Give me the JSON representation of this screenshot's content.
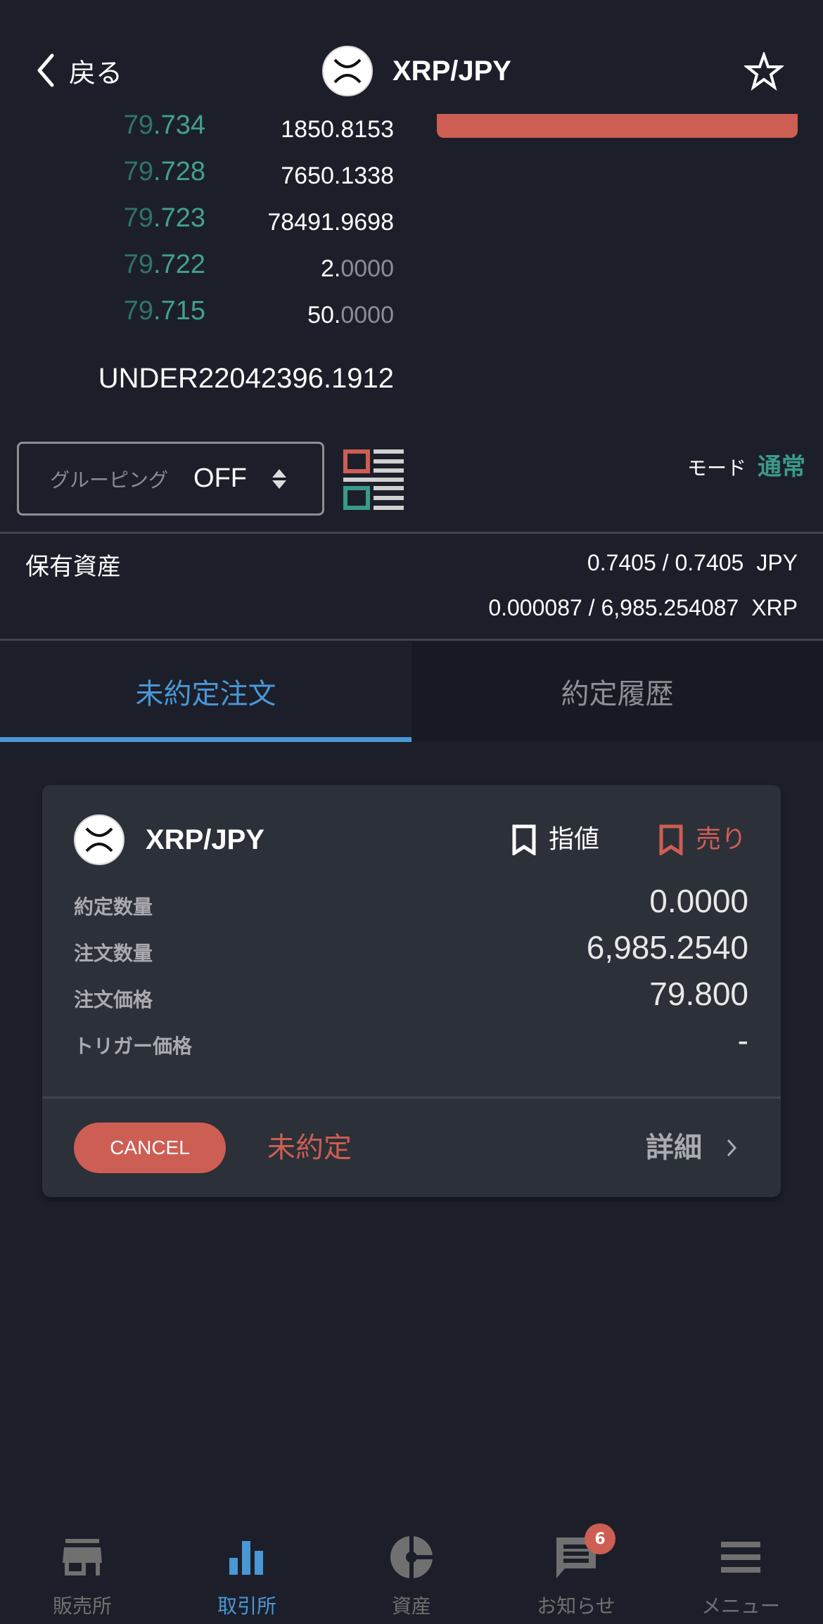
{
  "header": {
    "back_label": "戻る",
    "title": "XRP/JPY",
    "coin_icon": "xrp-logo-icon",
    "favorite_icon": "star-outline-icon"
  },
  "order_book": {
    "rows": [
      {
        "price_int": "79",
        "price_dec": ".734",
        "qty_main": "1850.8153",
        "qty_dim": ""
      },
      {
        "price_int": "79",
        "price_dec": ".728",
        "qty_main": "7650.1338",
        "qty_dim": ""
      },
      {
        "price_int": "79",
        "price_dec": ".723",
        "qty_main": "78491.9698",
        "qty_dim": ""
      },
      {
        "price_int": "79",
        "price_dec": ".722",
        "qty_main": "2.",
        "qty_dim": "0000"
      },
      {
        "price_int": "79",
        "price_dec": ".715",
        "qty_main": "50.",
        "qty_dim": "0000"
      }
    ],
    "under_total": "UNDER22042396.1912"
  },
  "controls": {
    "grouping_label": "グルーピング",
    "grouping_value": "OFF",
    "mode_label": "モード",
    "mode_value": "通常"
  },
  "assets": {
    "label": "保有資産",
    "lines": [
      {
        "amount": "0.7405 / 0.7405",
        "currency": "JPY"
      },
      {
        "amount": "0.000087 / 6,985.254087",
        "currency": "XRP"
      }
    ]
  },
  "tabs": [
    {
      "label": "未約定注文",
      "active": true
    },
    {
      "label": "約定履歴",
      "active": false
    }
  ],
  "order_card": {
    "pair": "XRP/JPY",
    "order_type": "指値",
    "side": "売り",
    "rows": [
      {
        "label": "約定数量",
        "value": "0.0000"
      },
      {
        "label": "注文数量",
        "value": "6,985.2540"
      },
      {
        "label": "注文価格",
        "value": "79.800"
      },
      {
        "label": "トリガー価格",
        "value": "-"
      }
    ],
    "cancel_label": "CANCEL",
    "status": "未約定",
    "detail_label": "詳細"
  },
  "bottom_nav": [
    {
      "label": "販売所",
      "icon": "store-icon",
      "active": false
    },
    {
      "label": "取引所",
      "icon": "bar-chart-icon",
      "active": true
    },
    {
      "label": "資産",
      "icon": "pie-chart-icon",
      "active": false
    },
    {
      "label": "お知らせ",
      "icon": "message-icon",
      "active": false,
      "badge": "6"
    },
    {
      "label": "メニュー",
      "icon": "menu-icon",
      "active": false
    }
  ],
  "colors": {
    "background": "#1c1f29",
    "card": "#2c3038",
    "accent_blue": "#4a97d6",
    "sell_red": "#cd5e53",
    "buy_green": "#3a9a8a"
  }
}
